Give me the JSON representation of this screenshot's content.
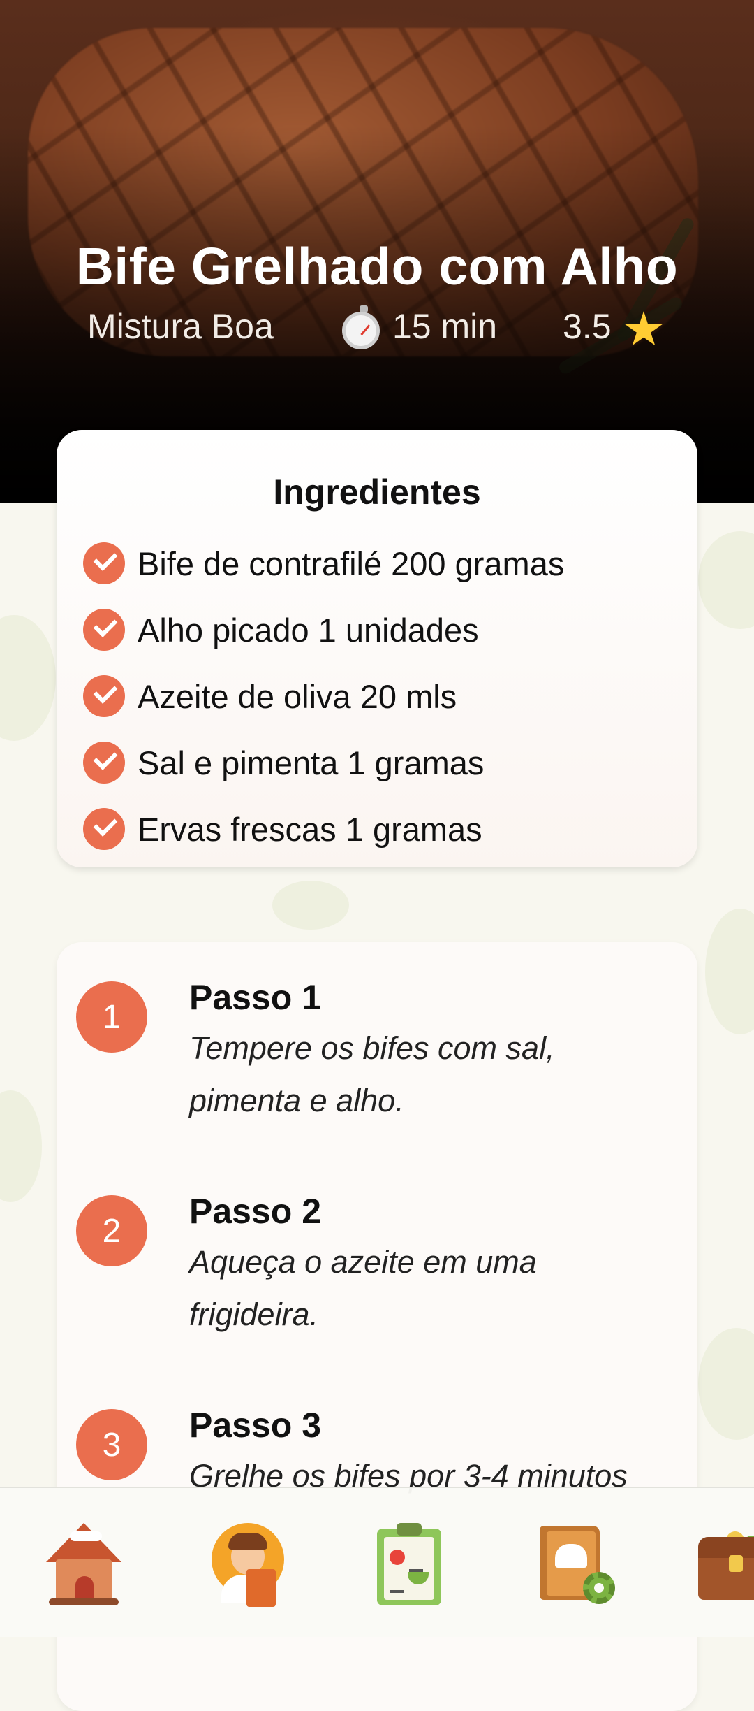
{
  "recipe": {
    "title": "Bife Grelhado com Alho",
    "category": "Mistura Boa",
    "time": "15 min",
    "rating": "3.5",
    "time_icon": "stopwatch-icon",
    "rating_icon": "star-icon"
  },
  "ingredients": {
    "title": "Ingredientes",
    "items": [
      "Bife de contrafilé 200 gramas",
      "Alho picado 1 unidades",
      "Azeite de oliva 20 mls",
      "Sal e pimenta 1 gramas",
      "Ervas frescas 1 gramas"
    ]
  },
  "steps": [
    {
      "number": "1",
      "title": "Passo 1",
      "text": "Tempere os bifes com sal, pimenta e alho."
    },
    {
      "number": "2",
      "title": "Passo 2",
      "text": "Aqueça o azeite em uma frigideira."
    },
    {
      "number": "3",
      "title": "Passo 3",
      "text": "Grelhe os bifes por 3-4 minutos"
    }
  ],
  "bottom_nav": {
    "items": [
      "home-icon",
      "profile-icon",
      "shopping-list-icon",
      "recipe-settings-icon",
      "pantry-chest-icon"
    ]
  },
  "colors": {
    "accent": "#ea6e4e",
    "background": "#f8f7ef",
    "card": "#ffffff",
    "star": "#ffcc33"
  }
}
